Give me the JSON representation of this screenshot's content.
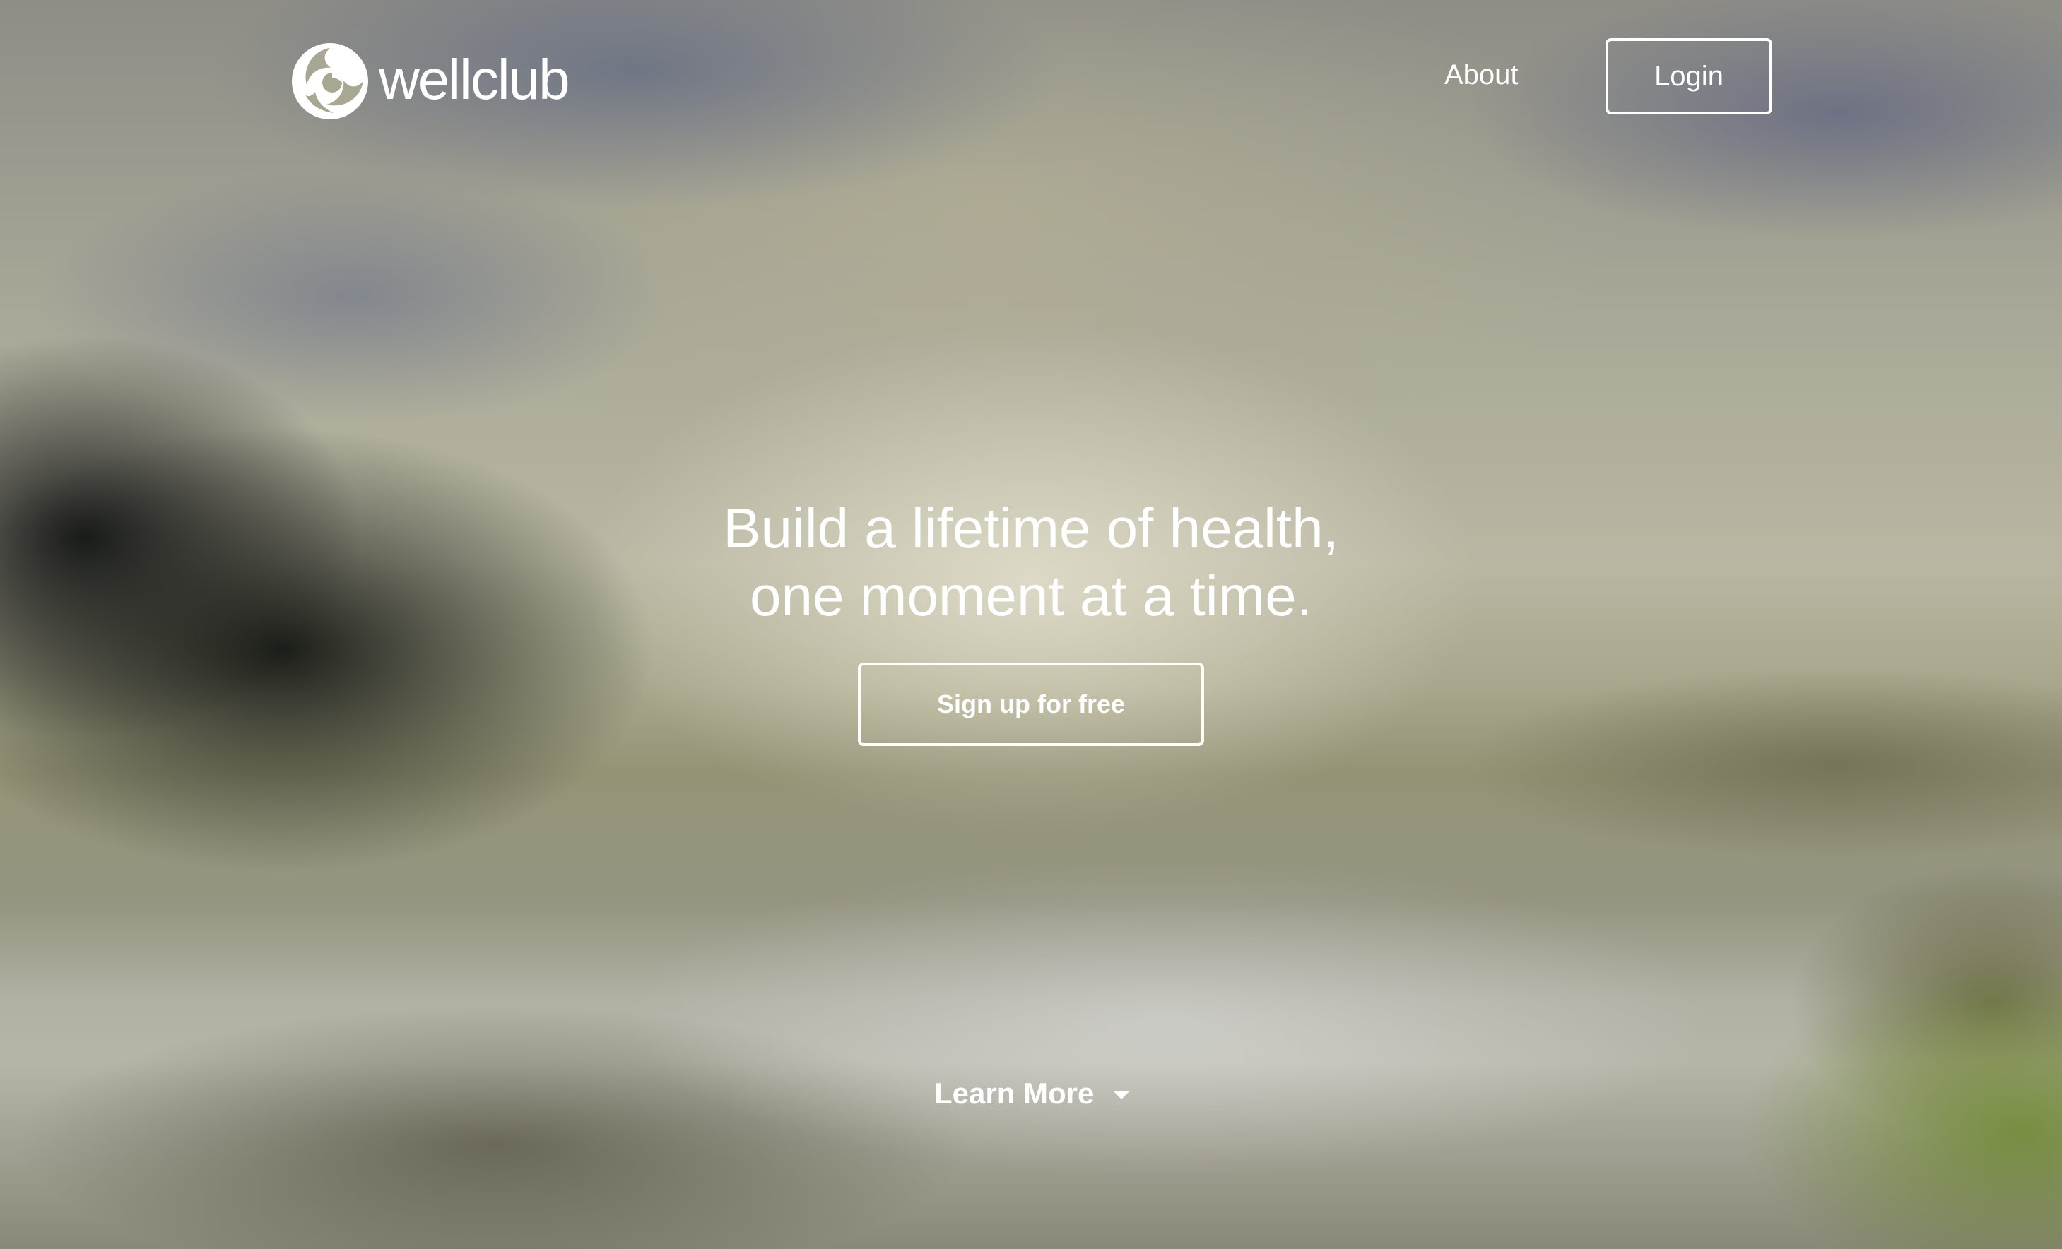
{
  "brand": {
    "name": "wellclub",
    "logo_icon": "wellclub-swirl-logo-icon"
  },
  "nav": {
    "about_label": "About",
    "login_label": "Login"
  },
  "hero": {
    "headline_line1": "Build a lifetime of health,",
    "headline_line2": "one moment at a time.",
    "signup_label": "Sign up for free"
  },
  "footer": {
    "learn_more_label": "Learn More",
    "learn_more_icon": "caret-down-icon"
  },
  "colors": {
    "text": "#ffffff",
    "button_border": "#ffffff"
  }
}
